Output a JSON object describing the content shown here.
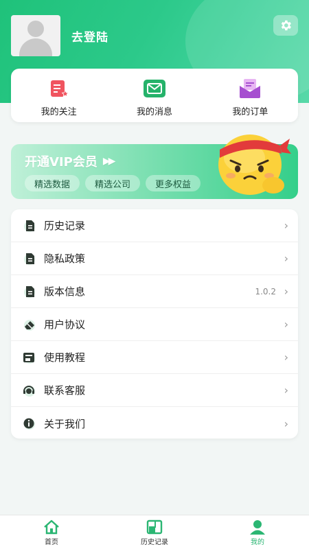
{
  "profile": {
    "login_text": "去登陆"
  },
  "quick_actions": [
    {
      "label": "我的关注",
      "icon": "follow-document-icon"
    },
    {
      "label": "我的消息",
      "icon": "message-envelope-icon"
    },
    {
      "label": "我的订单",
      "icon": "order-envelope-icon"
    }
  ],
  "vip": {
    "title": "开通VIP会员",
    "tags": [
      "精选数据",
      "精选公司",
      "更多权益"
    ]
  },
  "menu": [
    {
      "label": "历史记录",
      "icon": "document-icon",
      "value": ""
    },
    {
      "label": "隐私政策",
      "icon": "document-icon",
      "value": ""
    },
    {
      "label": "版本信息",
      "icon": "document-icon",
      "value": "1.0.2"
    },
    {
      "label": "用户协议",
      "icon": "eraser-icon",
      "value": ""
    },
    {
      "label": "使用教程",
      "icon": "tutorial-icon",
      "value": ""
    },
    {
      "label": "联系客服",
      "icon": "customer-service-icon",
      "value": ""
    },
    {
      "label": "关于我们",
      "icon": "info-icon",
      "value": ""
    }
  ],
  "tabbar": [
    {
      "label": "首页",
      "icon": "home-icon",
      "active": false
    },
    {
      "label": "历史记录",
      "icon": "history-icon",
      "active": false
    },
    {
      "label": "我的",
      "icon": "user-icon",
      "active": true
    }
  ],
  "colors": {
    "brand_green": "#2bb673",
    "header_green": "#1fc27a",
    "icon_dark": "#2f3a33",
    "follow_red": "#f0545f",
    "message_green": "#25b26a",
    "order_purple": "#a64fd0"
  }
}
